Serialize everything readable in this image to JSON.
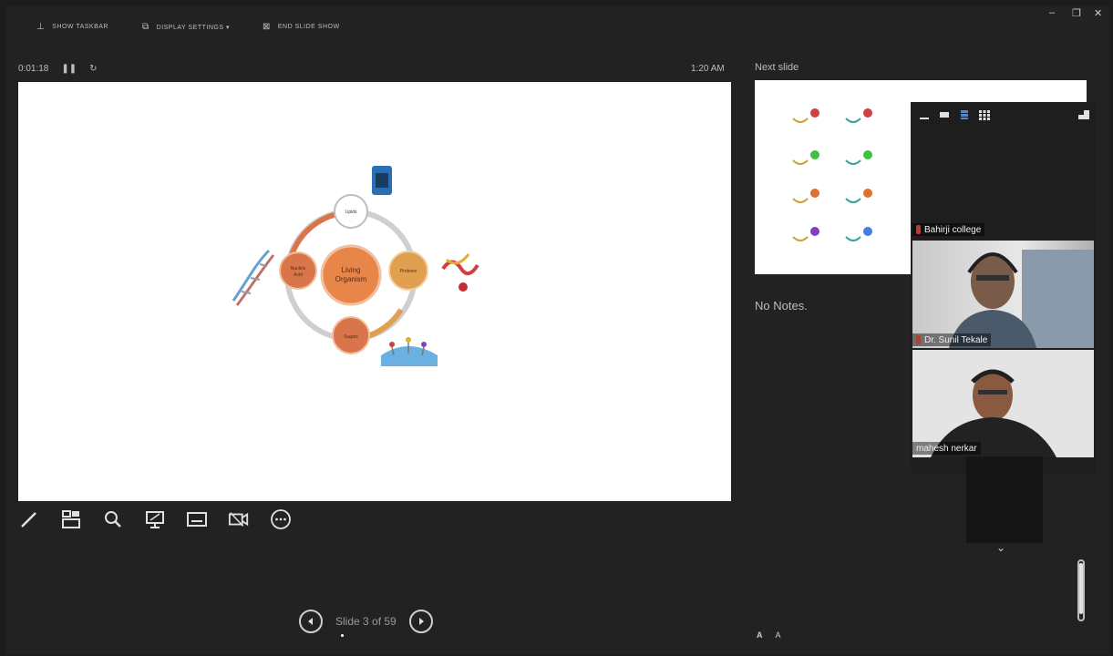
{
  "toolbar": {
    "show_taskbar": "SHOW TASKBAR",
    "display_settings": "DISPLAY SETTINGS ▾",
    "end_slide_show": "END SLIDE SHOW"
  },
  "window_controls": {
    "minimize": "–",
    "restore": "❐",
    "close": "✕"
  },
  "timer": {
    "elapsed": "0:01:18",
    "pause_icon": "pause-icon",
    "reset_icon": "reset-icon"
  },
  "clock": "1:20 AM",
  "slide_content": {
    "center": [
      "Living",
      "Organism"
    ],
    "top": "Lipids",
    "right": "Proteins",
    "bottom": "Sugars",
    "left": [
      "Nucleic",
      "Acid"
    ]
  },
  "tools": [
    "pen-tool-icon",
    "see-all-slides-icon",
    "zoom-icon",
    "pointer-options-icon",
    "subtitles-icon",
    "camera-icon",
    "more-options-icon"
  ],
  "navigation": {
    "label": "Slide 3 of 59"
  },
  "next_slide": {
    "label": "Next slide"
  },
  "notes": {
    "text": "No Notes."
  },
  "font_controls": {
    "increase": "A",
    "decrease": "A"
  },
  "meeting": {
    "participants": [
      {
        "name": "Bahirji college"
      },
      {
        "name": "Dr. Sunil Tekale"
      },
      {
        "name": "mahesh nerkar"
      }
    ]
  },
  "colors": {
    "background": "#222222",
    "slide_bg": "#ffffff",
    "node_orange": "#e08040",
    "ring_grey": "#cfcfcf"
  }
}
